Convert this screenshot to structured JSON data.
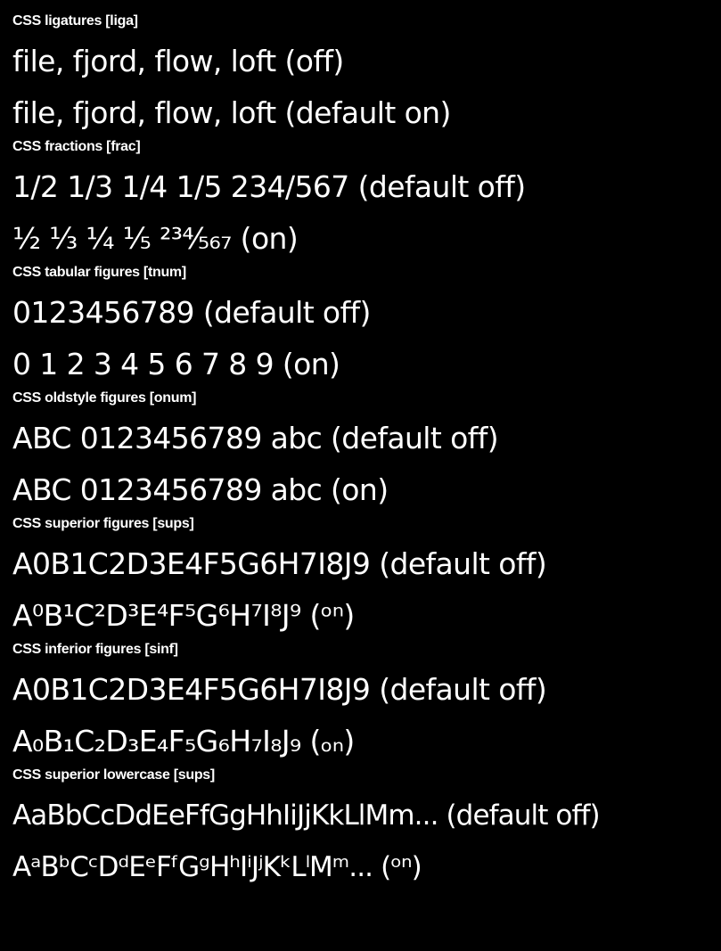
{
  "sections": [
    {
      "label": "CSS ligatures [liga]",
      "off": "file, fjord, flow, loft (off)",
      "on": "file, fjord, flow, loft (default on)"
    },
    {
      "label": "CSS fractions [frac]",
      "off": "1/2 1/3 1/4 1/5 234/567 (default off)",
      "on": "½ ⅓ ¼ ⅕ ²³⁴⁄₅₆₇ (on)"
    },
    {
      "label": "CSS tabular figures [tnum]",
      "off": "0123456789 (default off)",
      "on": "0 1 2 3 4 5 6 7 8 9 (on)"
    },
    {
      "label": "CSS oldstyle figures [onum]",
      "off": "ABC 0123456789 abc (default off)",
      "on": "ABC 0123456789 abc (on)"
    },
    {
      "label": "CSS superior figures [sups]",
      "off": "A0B1C2D3E4F5G6H7I8J9 (default off)",
      "on": "A⁰B¹C²D³E⁴F⁵G⁶H⁷I⁸J⁹ (ᵒⁿ)"
    },
    {
      "label": "CSS inferior figures [sinf]",
      "off": "A0B1C2D3E4F5G6H7I8J9 (default off)",
      "on": "A₀B₁C₂D₃E₄F₅G₆H₇I₈J₉ (ₒₙ)"
    },
    {
      "label": "CSS superior lowercase [sups]",
      "off": "AaBbCcDdEeFfGgHhIiJjKkLlMm... (default off)",
      "on": "AᵃBᵇCᶜDᵈEᵉFᶠGᵍHʰIⁱJʲKᵏLˡMᵐ... (ᵒⁿ)"
    }
  ]
}
